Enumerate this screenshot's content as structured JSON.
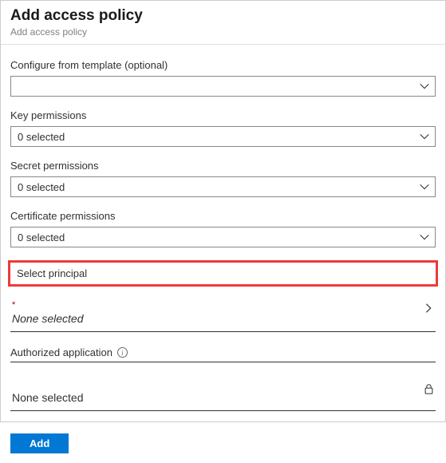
{
  "header": {
    "title": "Add access policy",
    "subtitle": "Add access policy"
  },
  "fields": {
    "template": {
      "label": "Configure from template (optional)",
      "value": ""
    },
    "key": {
      "label": "Key permissions",
      "value": "0 selected"
    },
    "secret": {
      "label": "Secret permissions",
      "value": "0 selected"
    },
    "cert": {
      "label": "Certificate permissions",
      "value": "0 selected"
    }
  },
  "principal": {
    "heading": "Select principal",
    "required_mark": "*",
    "value": "None selected"
  },
  "auth_app": {
    "label": "Authorized application",
    "value": "None selected"
  },
  "buttons": {
    "add": "Add"
  }
}
